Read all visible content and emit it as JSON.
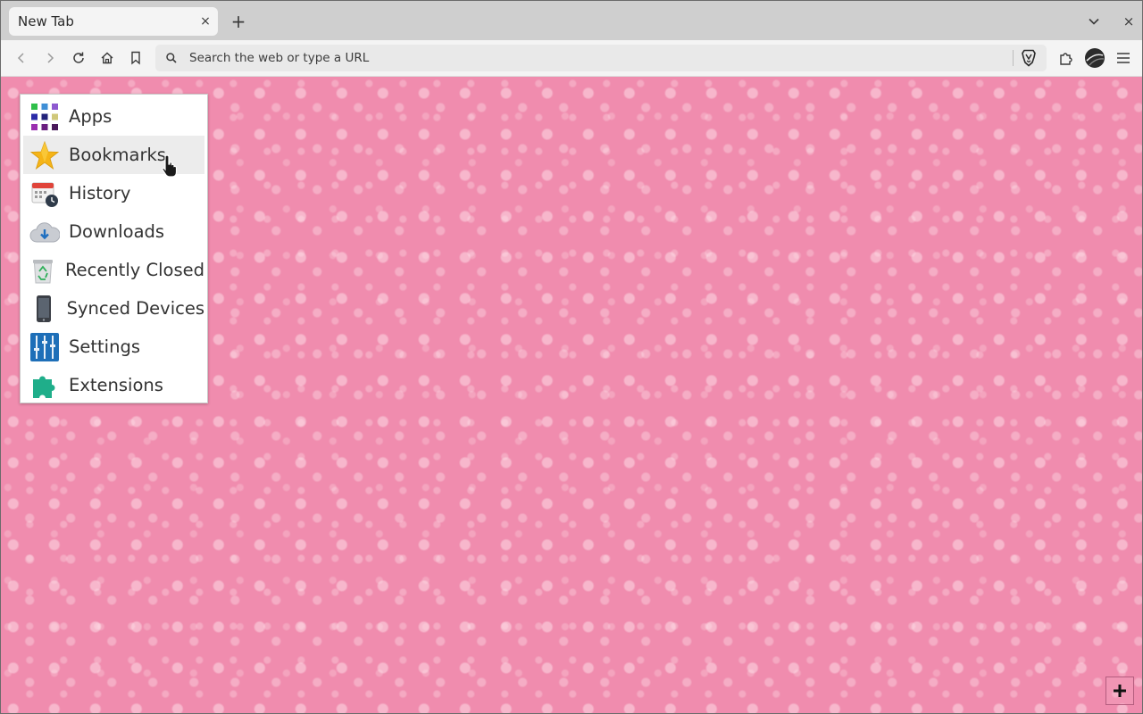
{
  "tab": {
    "title": "New Tab",
    "close_label": "×"
  },
  "tabstrip": {
    "new_tab_label": "+",
    "close_window_label": "×"
  },
  "toolbar": {
    "url_placeholder": "Search the web or type a URL"
  },
  "menu": {
    "items": [
      {
        "label": "Apps",
        "icon": "apps-grid-icon"
      },
      {
        "label": "Bookmarks",
        "icon": "star-icon",
        "hovered": true
      },
      {
        "label": "History",
        "icon": "calendar-clock-icon"
      },
      {
        "label": "Downloads",
        "icon": "cloud-download-icon"
      },
      {
        "label": "Recently Closed",
        "icon": "recycle-bin-icon"
      },
      {
        "label": "Synced Devices",
        "icon": "phone-icon"
      },
      {
        "label": "Settings",
        "icon": "sliders-icon"
      },
      {
        "label": "Extensions",
        "icon": "puzzle-piece-icon"
      }
    ]
  },
  "colors": {
    "page_background": "#f08cae",
    "menu_hover": "#ececec"
  }
}
